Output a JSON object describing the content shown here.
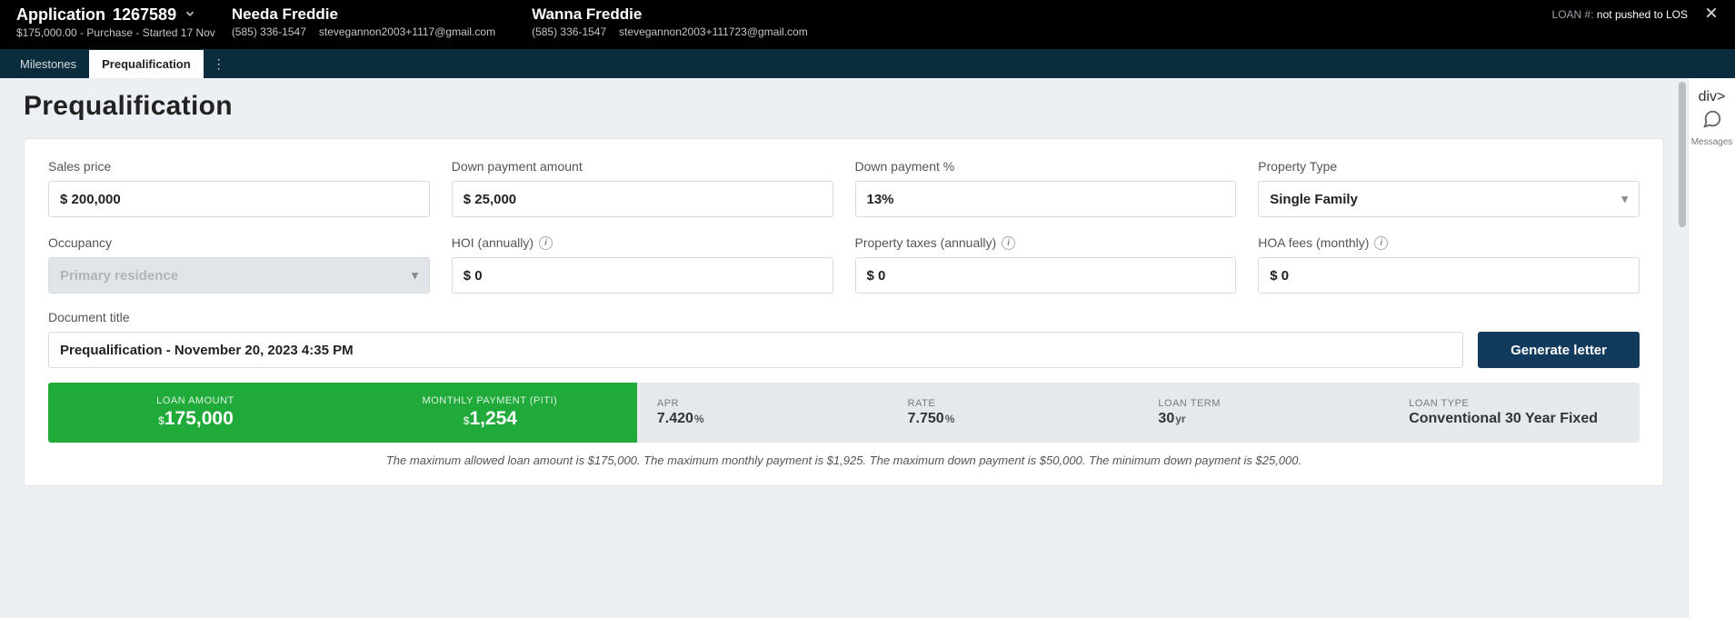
{
  "header": {
    "application_label": "Application",
    "application_number": "1267589",
    "application_sub": "$175,000.00 - Purchase - Started 17 Nov",
    "contacts": [
      {
        "name": "Needa Freddie",
        "phone": "(585) 336-1547",
        "email": "stevegannon2003+1117@gmail.com"
      },
      {
        "name": "Wanna Freddie",
        "phone": "(585) 336-1547",
        "email": "stevegannon2003+111723@gmail.com"
      }
    ],
    "loan_label": "LOAN #:",
    "loan_value": "not pushed to LOS"
  },
  "tabs": {
    "milestones": "Milestones",
    "prequal": "Prequalification"
  },
  "side": {
    "messages": "Messages"
  },
  "page_title": "Prequalification",
  "fields": {
    "sales_price": {
      "label": "Sales price",
      "value": "$ 200,000"
    },
    "down_payment_amount": {
      "label": "Down payment amount",
      "value": "$ 25,000"
    },
    "down_payment_pct": {
      "label": "Down payment %",
      "value": "13%"
    },
    "property_type": {
      "label": "Property Type",
      "value": "Single Family"
    },
    "occupancy": {
      "label": "Occupancy",
      "value": "Primary residence"
    },
    "hoi": {
      "label": "HOI (annually)",
      "value": "$ 0"
    },
    "taxes": {
      "label": "Property taxes (annually)",
      "value": "$ 0"
    },
    "hoa": {
      "label": "HOA fees (monthly)",
      "value": "$ 0"
    },
    "doc_title": {
      "label": "Document title",
      "value": "Prequalification - November 20, 2023 4:35 PM"
    }
  },
  "generate_label": "Generate letter",
  "summary": {
    "loan_amount": {
      "label": "LOAN AMOUNT",
      "prefix": "$",
      "value": "175,000"
    },
    "monthly_payment": {
      "label": "MONTHLY PAYMENT (PITI)",
      "prefix": "$",
      "value": "1,254"
    },
    "apr": {
      "label": "APR",
      "value": "7.420",
      "unit": "%"
    },
    "rate": {
      "label": "RATE",
      "value": "7.750",
      "unit": "%"
    },
    "term": {
      "label": "LOAN TERM",
      "value": "30",
      "unit": "yr"
    },
    "type": {
      "label": "LOAN TYPE",
      "value": "Conventional 30 Year Fixed"
    }
  },
  "note": "The maximum allowed loan amount is $175,000. The maximum monthly payment is $1,925. The maximum down payment is $50,000. The minimum down payment is $25,000."
}
